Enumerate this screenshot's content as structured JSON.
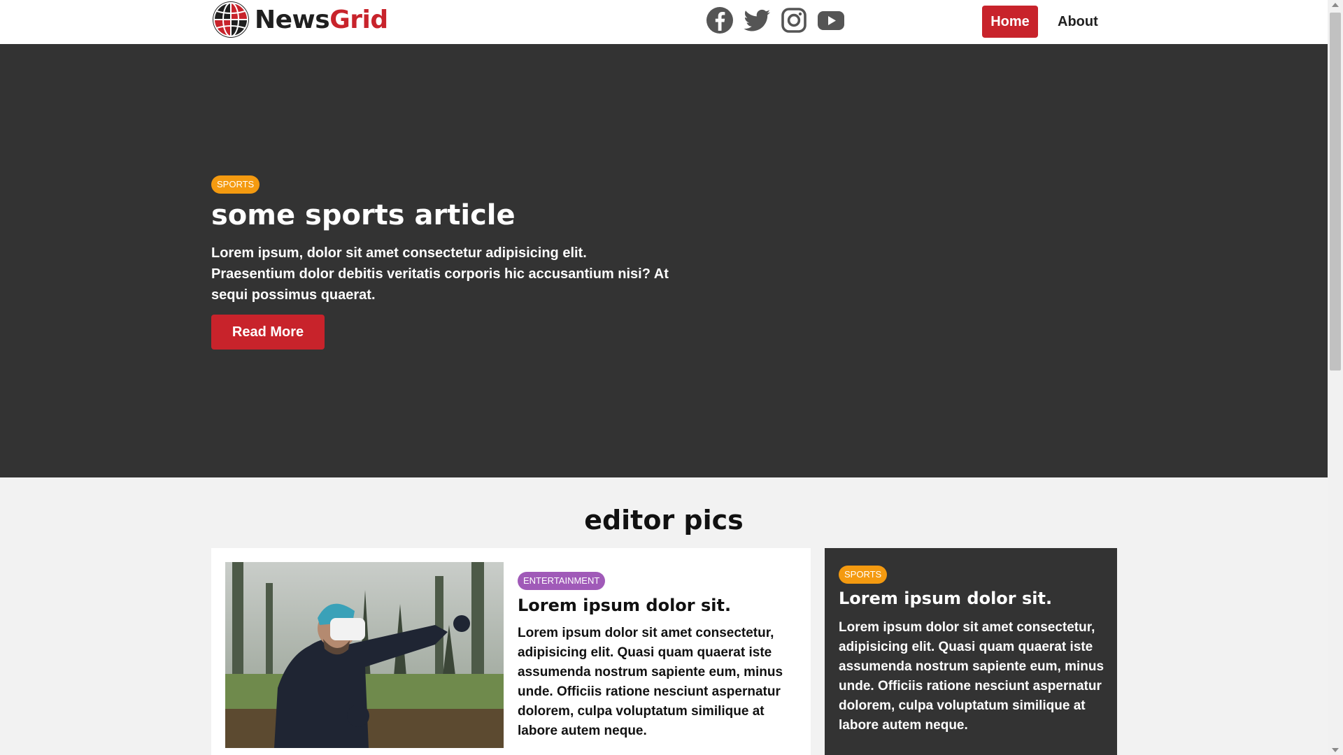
{
  "brand": {
    "name_part1": "News",
    "name_part2": "Grid",
    "logo_icon": "globe-icon",
    "accent_color": "#c8232b"
  },
  "social": [
    {
      "name": "facebook-icon",
      "color": "#555555"
    },
    {
      "name": "twitter-icon",
      "color": "#555555"
    },
    {
      "name": "instagram-icon",
      "color": "#555555"
    },
    {
      "name": "youtube-icon",
      "color": "#555555"
    }
  ],
  "nav": {
    "home_label": "Home",
    "about_label": "About"
  },
  "hero": {
    "category": "SPORTS",
    "category_color": "#f49a10",
    "title": "some sports article",
    "text": "Lorem ipsum, dolor sit amet consectetur adipisicing elit. Praesentium dolor debitis veritatis corporis hic accusantium nisi? At sequi possimus quaerat.",
    "button_label": "Read More",
    "background": "#333333"
  },
  "editor_pics": {
    "section_title": "editor pics",
    "main_card": {
      "category": "ENTERTAINMENT",
      "category_color": "#a05ab8",
      "title": "Lorem ipsum dolor sit.",
      "text": "Lorem ipsum dolor sit amet consectetur, adipisicing elit. Quasi quam quaerat iste assumenda nostrum sapiente eum, minus unde. Officiis ratione nesciunt aspernatur dolorem, culpa voluptatum similique at labore autem neque."
    },
    "side_card": {
      "category": "SPORTS",
      "category_color": "#f49a10",
      "title": "Lorem ipsum dolor sit.",
      "text": "Lorem ipsum dolor sit amet consectetur, adipisicing elit. Quasi quam quaerat iste assumenda nostrum sapiente eum, minus unde. Officiis ratione nesciunt aspernatur dolorem, culpa voluptatum similique at labore autem neque."
    }
  }
}
